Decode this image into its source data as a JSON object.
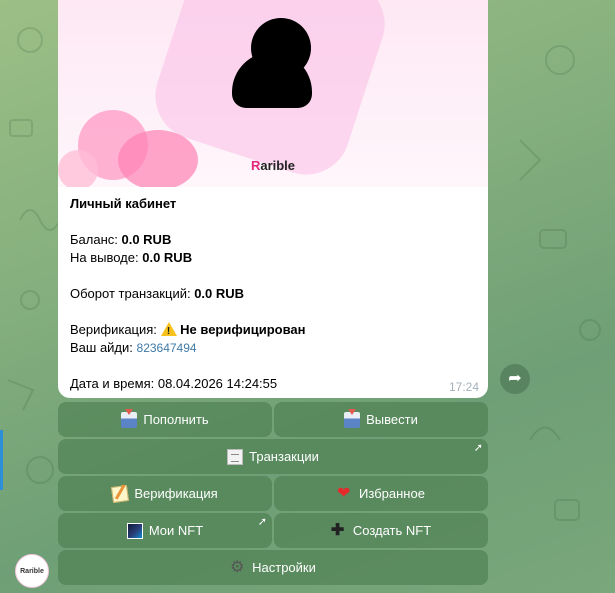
{
  "message": {
    "brand": {
      "initial": "R",
      "rest": "arible"
    },
    "title": "Личный кабинет",
    "balance_label": "Баланс: ",
    "balance_value": "0.0 RUB",
    "withdraw_label": "На выводе: ",
    "withdraw_value": "0.0 RUB",
    "turnover_label": "Оборот транзакций: ",
    "turnover_value": "0.0 RUB",
    "verification_label": "Верификация: ",
    "verification_value": "Не верифицирован",
    "id_label": "Ваш айди: ",
    "id_value": "823647494",
    "datetime_label": "Дата и время: ",
    "datetime_value": "08.04.2026 14:24:55",
    "time": "17:24"
  },
  "keyboard": {
    "deposit": "Пополнить",
    "withdraw": "Вывести",
    "transactions": "Транзакции",
    "verification": "Верификация",
    "favorites": "Избранное",
    "my_nft": "Мои NFT",
    "create_nft": "Создать NFT",
    "settings": "Настройки"
  },
  "bot": {
    "avatar_text": "Rarible"
  },
  "icons": {
    "share": "share-arrow-icon",
    "deposit": "inbox-tray-icon",
    "withdraw": "inbox-tray-icon",
    "transactions": "page-icon",
    "verification": "memo-icon",
    "favorites": "red-heart-icon",
    "my_nft": "nft-image-icon",
    "create_nft": "plus-icon",
    "settings": "gear-icon",
    "warning": "warning-icon"
  },
  "colors": {
    "brand_accent": "#e5297a",
    "link": "#3e7aa8",
    "button_bg": "#46784b",
    "message_bg": "#ffffff"
  }
}
